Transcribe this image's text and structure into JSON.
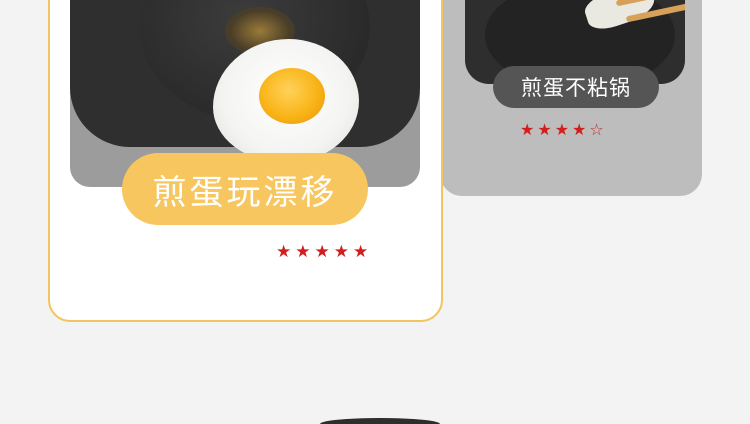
{
  "cards": {
    "left": {
      "label": "煎蛋玩漂移",
      "rating": 5,
      "stars": [
        "★",
        "★",
        "★",
        "★",
        "★"
      ]
    },
    "right": {
      "label": "煎蛋不粘锅",
      "rating": 4,
      "stars": [
        "★",
        "★",
        "★",
        "★",
        "☆"
      ]
    }
  },
  "colors": {
    "accent": "#f7c65e",
    "star": "#d21e1e",
    "pill_dark": "#555555"
  }
}
